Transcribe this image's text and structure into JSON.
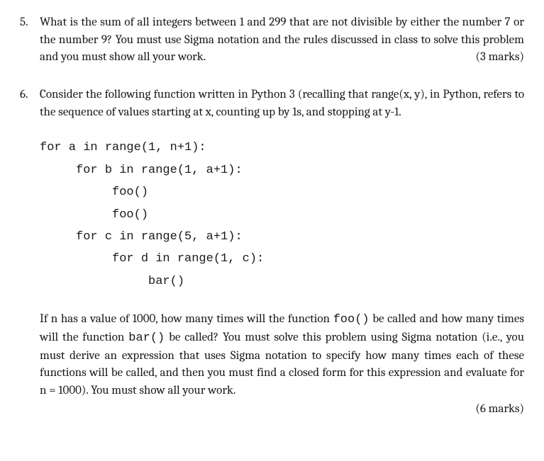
{
  "q5": {
    "number": "5.",
    "text_part1": "What is the sum of all integers between 1 and 299 that are not divisible by either the number 7 or the number 9? You must use Sigma notation and the rules discussed in class to solve this problem and you must show all your work.",
    "marks": "(3 marks)"
  },
  "q6": {
    "number": "6.",
    "intro": "Consider the following function written in Python 3 (recalling that range(x, y), in Python, refers to the sequence of values starting at x, counting up by 1s, and stopping at y-1.",
    "code": "for a in range(1, n+1):\n     for b in range(1, a+1):\n          foo()\n          foo()\n     for c in range(5, a+1):\n          for d in range(1, c):\n               bar()",
    "followup_a": "If n has a value of 1000, how many times will the function ",
    "code_foo": "foo()",
    "followup_b": " be called and how many times will the function ",
    "code_bar": "bar()",
    "followup_c": " be called? You must solve this problem using Sigma notation (i.e., you must derive an expression that uses Sigma notation to specify how many times each of these functions will be called, and then you must find a closed form for this expression and evaluate for n = 1000). You must show all your work.",
    "marks": "(6 marks)"
  }
}
